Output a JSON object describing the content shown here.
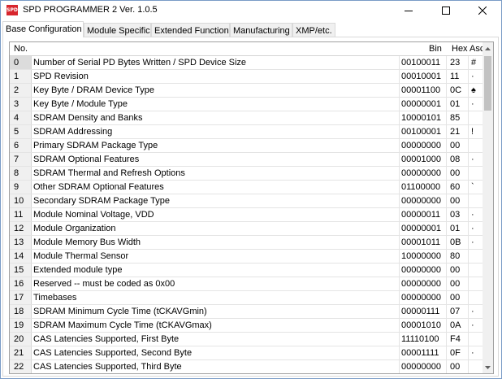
{
  "window": {
    "title": "SPD PROGRAMMER 2 Ver. 1.0.5",
    "icon_name": "spd-app-icon",
    "icon_text": "SPD"
  },
  "tabs": [
    {
      "label": "Base Configuration",
      "active": true
    },
    {
      "label": "Module Specific",
      "active": false
    },
    {
      "label": "Extended Function",
      "active": false
    },
    {
      "label": "Manufacturing",
      "active": false
    },
    {
      "label": "XMP/etc.",
      "active": false
    }
  ],
  "table": {
    "columns": {
      "no": "No.",
      "name": "",
      "bin": "Bin",
      "hex": "Hex",
      "asc": "Asc"
    },
    "rows": [
      {
        "no": "0",
        "name": "Number of Serial PD Bytes Written / SPD Device Size",
        "bin": "00100011",
        "hex": "23",
        "asc": "#"
      },
      {
        "no": "1",
        "name": "SPD Revision",
        "bin": "00010001",
        "hex": "11",
        "asc": "·"
      },
      {
        "no": "2",
        "name": "Key Byte / DRAM Device Type",
        "bin": "00001100",
        "hex": "0C",
        "asc": "♠"
      },
      {
        "no": "3",
        "name": "Key Byte / Module Type",
        "bin": "00000001",
        "hex": "01",
        "asc": "·"
      },
      {
        "no": "4",
        "name": "SDRAM Density and Banks",
        "bin": "10000101",
        "hex": "85",
        "asc": ""
      },
      {
        "no": "5",
        "name": "SDRAM Addressing",
        "bin": "00100001",
        "hex": "21",
        "asc": "!"
      },
      {
        "no": "6",
        "name": "Primary SDRAM Package Type",
        "bin": "00000000",
        "hex": "00",
        "asc": ""
      },
      {
        "no": "7",
        "name": "SDRAM Optional Features",
        "bin": "00001000",
        "hex": "08",
        "asc": "·"
      },
      {
        "no": "8",
        "name": "SDRAM Thermal and Refresh Options",
        "bin": "00000000",
        "hex": "00",
        "asc": ""
      },
      {
        "no": "9",
        "name": "Other SDRAM Optional Features",
        "bin": "01100000",
        "hex": "60",
        "asc": "`"
      },
      {
        "no": "10",
        "name": "Secondary SDRAM Package Type",
        "bin": "00000000",
        "hex": "00",
        "asc": ""
      },
      {
        "no": "11",
        "name": "Module Nominal Voltage, VDD",
        "bin": "00000011",
        "hex": "03",
        "asc": "·"
      },
      {
        "no": "12",
        "name": "Module Organization",
        "bin": "00000001",
        "hex": "01",
        "asc": "·"
      },
      {
        "no": "13",
        "name": "Module Memory Bus Width",
        "bin": "00001011",
        "hex": "0B",
        "asc": "·"
      },
      {
        "no": "14",
        "name": "Module Thermal Sensor",
        "bin": "10000000",
        "hex": "80",
        "asc": ""
      },
      {
        "no": "15",
        "name": "Extended module type",
        "bin": "00000000",
        "hex": "00",
        "asc": ""
      },
      {
        "no": "16",
        "name": "Reserved -- must be coded as 0x00",
        "bin": "00000000",
        "hex": "00",
        "asc": ""
      },
      {
        "no": "17",
        "name": "Timebases",
        "bin": "00000000",
        "hex": "00",
        "asc": ""
      },
      {
        "no": "18",
        "name": "SDRAM Minimum Cycle Time (tCKAVGmin)",
        "bin": "00000111",
        "hex": "07",
        "asc": "·"
      },
      {
        "no": "19",
        "name": "SDRAM Maximum Cycle Time (tCKAVGmax)",
        "bin": "00001010",
        "hex": "0A",
        "asc": "·"
      },
      {
        "no": "20",
        "name": "CAS Latencies Supported, First Byte",
        "bin": "11110100",
        "hex": "F4",
        "asc": ""
      },
      {
        "no": "21",
        "name": "CAS Latencies Supported, Second Byte",
        "bin": "00001111",
        "hex": "0F",
        "asc": "·"
      },
      {
        "no": "22",
        "name": "CAS Latencies Supported, Third Byte",
        "bin": "00000000",
        "hex": "00",
        "asc": ""
      }
    ],
    "selected_row": "0"
  }
}
